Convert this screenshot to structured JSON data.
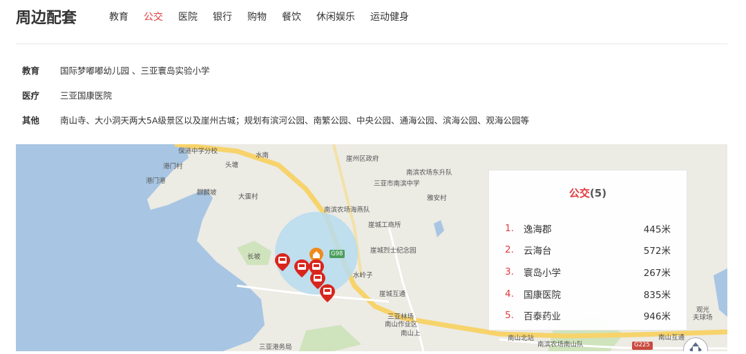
{
  "header": {
    "title": "周边配套",
    "tabs": [
      {
        "label": "教育",
        "active": false
      },
      {
        "label": "公交",
        "active": true
      },
      {
        "label": "医院",
        "active": false
      },
      {
        "label": "银行",
        "active": false
      },
      {
        "label": "购物",
        "active": false
      },
      {
        "label": "餐饮",
        "active": false
      },
      {
        "label": "休闲娱乐",
        "active": false
      },
      {
        "label": "运动健身",
        "active": false
      }
    ]
  },
  "info": [
    {
      "label": "教育",
      "value": "国际梦嘟嘟幼儿园 、三亚寰岛实验小学"
    },
    {
      "label": "医疗",
      "value": "三亚国康医院"
    },
    {
      "label": "其他",
      "value": "南山寺、大小洞天两大5A级景区以及崖州古城；规划有滨河公园、南繁公园、中央公园、通海公园、滨海公园、观海公园等"
    }
  ],
  "map": {
    "labels": {
      "baogang": "保港中学分校",
      "shuinan": "水南",
      "yazhou_gov": "崖州区政府",
      "gangmencun": "港门村",
      "toutang": "头塘",
      "nanbin_dongsheng": "南滨农场东升队",
      "gangmengang": "港门港",
      "nanbin_school": "三亚市南滨中学",
      "qilinpo": "麒麟坡",
      "dadancun": "大蛋村",
      "yaancun": "雅安村",
      "nanbin_haiyan": "南滨农场海燕队",
      "yacheng_shop": "崖城工商所",
      "yacheng_memorial": "崖城烈士纪念园",
      "road_g98": "G98",
      "changpo": "长坡",
      "shuilingzi": "水岭子",
      "yacheng_interchange": "崖城互通",
      "sanya_forest": "三亚林场",
      "nanshan_workarea": "南山作业区",
      "nanshan_shang": "南山上",
      "nanshan_north": "南山北站",
      "nanbin_nanshan": "南滨农场南山队",
      "road_g225": "G225",
      "nanshan_interchange": "南山互通",
      "sanya_port": "三亚港务局",
      "guanguang": "观光",
      "farm": "夫球场"
    },
    "colors": {
      "sea": "#a8c6e3",
      "land": "#ecebe4",
      "highway": "#f7d36b",
      "circle": "#b7dcf0",
      "marker": "#d9251c",
      "home": "#f08a1c"
    }
  },
  "panel": {
    "title": "公交",
    "count": "(5)",
    "items": [
      {
        "index": "1.",
        "name": "逸海郡",
        "distance": "445米"
      },
      {
        "index": "2.",
        "name": "云海台",
        "distance": "572米"
      },
      {
        "index": "3.",
        "name": "寰岛小学",
        "distance": "267米"
      },
      {
        "index": "4.",
        "name": "国康医院",
        "distance": "835米"
      },
      {
        "index": "5.",
        "name": "百泰药业",
        "distance": "946米"
      }
    ]
  }
}
